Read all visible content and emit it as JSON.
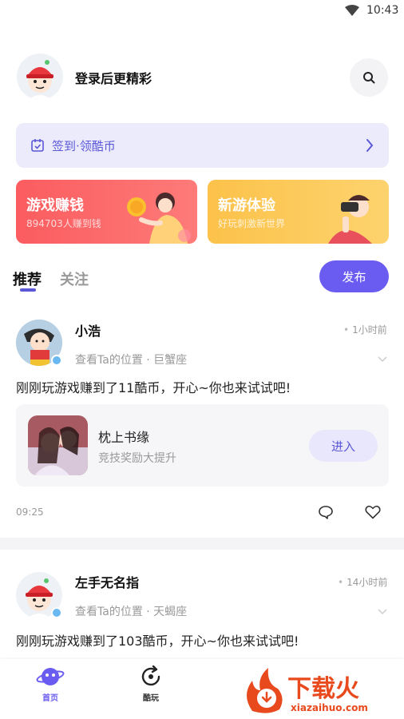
{
  "status_bar": {
    "time": "10:43"
  },
  "header": {
    "login_text": "登录后更精彩"
  },
  "signin": {
    "label": "签到·领酷币"
  },
  "promos": [
    {
      "title": "游戏赚钱",
      "subtitle": "894703人赚到钱"
    },
    {
      "title": "新游体验",
      "subtitle": "好玩刺激新世界"
    }
  ],
  "tabs": {
    "recommend": "推荐",
    "follow": "关注"
  },
  "publish_label": "发布",
  "posts": [
    {
      "name": "小浩",
      "time_ago": "1小时前",
      "location": "查看Ta的位置 · 巨蟹座",
      "text": "刚刚玩游戏赚到了11酷币，开心~你也来试试吧!",
      "game": {
        "name": "枕上书缘",
        "desc": "竞技奖励大提升",
        "button": "进入"
      },
      "clock": "09:25"
    },
    {
      "name": "左手无名指",
      "time_ago": "14小时前",
      "location": "查看Ta的位置 · 天蝎座",
      "text": "刚刚玩游戏赚到了103酷币，开心~你也来试试吧!"
    }
  ],
  "bottom_nav": [
    {
      "label": "首页",
      "icon": "planet-icon",
      "active": true
    },
    {
      "label": "酷玩",
      "icon": "refresh-circle-icon",
      "active": false
    }
  ],
  "watermark": {
    "brand": "下载火",
    "domain": "xiazaihuo.com"
  },
  "colors": {
    "accent": "#6a5cf0",
    "promo_red": "#fb5c5f",
    "promo_yellow": "#fcc24a"
  }
}
